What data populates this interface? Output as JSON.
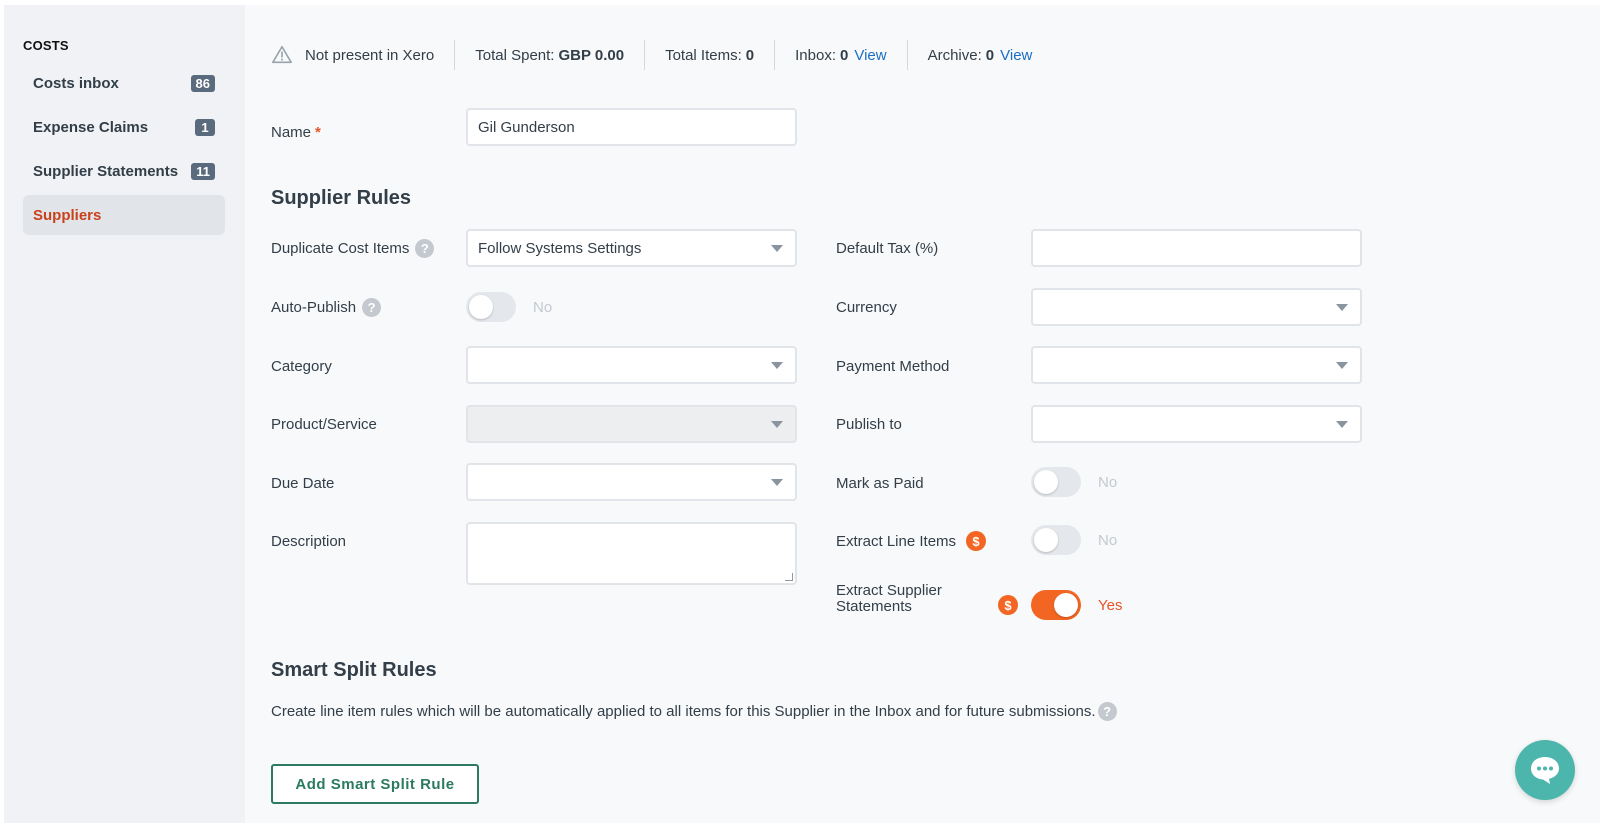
{
  "sidebar": {
    "heading": "COSTS",
    "items": [
      {
        "label": "Costs inbox",
        "count": "86"
      },
      {
        "label": "Expense Claims",
        "count": "1"
      },
      {
        "label": "Supplier Statements",
        "count": "11"
      },
      {
        "label": "Suppliers",
        "count": ""
      }
    ],
    "active_index": 3
  },
  "status_bar": {
    "xero_status": "Not present in Xero",
    "total_spent_label": "Total Spent:",
    "total_spent_value": "GBP 0.00",
    "total_items_label": "Total Items:",
    "total_items_value": "0",
    "inbox_label": "Inbox:",
    "inbox_value": "0",
    "inbox_link": "View",
    "archive_label": "Archive:",
    "archive_value": "0",
    "archive_link": "View"
  },
  "name_field": {
    "label": "Name",
    "required_mark": "*",
    "value": "Gil Gunderson"
  },
  "supplier_rules": {
    "title": "Supplier Rules",
    "duplicate_cost_items": {
      "label": "Duplicate Cost Items",
      "value": "Follow Systems Settings"
    },
    "auto_publish": {
      "label": "Auto-Publish",
      "state": "No"
    },
    "category": {
      "label": "Category",
      "value": ""
    },
    "product_service": {
      "label": "Product/Service",
      "value": ""
    },
    "due_date": {
      "label": "Due Date",
      "value": ""
    },
    "description": {
      "label": "Description",
      "value": ""
    },
    "default_tax": {
      "label": "Default Tax (%)",
      "value": ""
    },
    "currency": {
      "label": "Currency",
      "value": ""
    },
    "payment_method": {
      "label": "Payment Method",
      "value": ""
    },
    "publish_to": {
      "label": "Publish to",
      "value": ""
    },
    "mark_as_paid": {
      "label": "Mark as Paid",
      "state": "No"
    },
    "extract_line_items": {
      "label": "Extract Line Items",
      "state": "No"
    },
    "extract_supplier_statements": {
      "label_line1": "Extract Supplier",
      "label_line2": "Statements",
      "state": "Yes"
    }
  },
  "smart_split": {
    "title": "Smart Split Rules",
    "description": "Create line item rules which will be automatically applied to all items for this Supplier in the Inbox and for future submissions.",
    "add_button": "Add Smart Split Rule"
  },
  "icons": {
    "help": "?",
    "dollar": "$",
    "warning": "warning-triangle-icon",
    "chat": "chat-bubble-icon"
  },
  "colors": {
    "accent_orange": "#f26522",
    "active_nav_text": "#c8421c",
    "link_blue": "#1b6ec2",
    "button_green": "#2c7a5f",
    "chat_teal": "#4db6ac"
  }
}
